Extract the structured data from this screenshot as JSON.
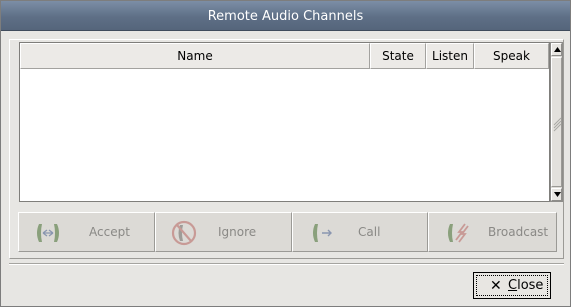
{
  "window": {
    "title": "Remote Audio Channels"
  },
  "table": {
    "columns": [
      "Name",
      "State",
      "Listen",
      "Speak"
    ],
    "rows": []
  },
  "actions": {
    "accept_label": "Accept",
    "ignore_label": "Ignore",
    "call_label": "Call",
    "broadcast_label": "Broadcast",
    "enabled": false
  },
  "footer": {
    "close_label_mnemonic": "C",
    "close_label_rest": "lose",
    "close_icon_glyph": "✕"
  },
  "icons": {
    "accept": "phone-accept-icon",
    "ignore": "phone-ignore-icon",
    "call": "phone-call-icon",
    "broadcast": "broadcast-icon",
    "close": "close-icon"
  },
  "colors": {
    "titlebar": "#5e6f86",
    "disabled_text": "#8a8986",
    "background": "#e7e6e3"
  }
}
